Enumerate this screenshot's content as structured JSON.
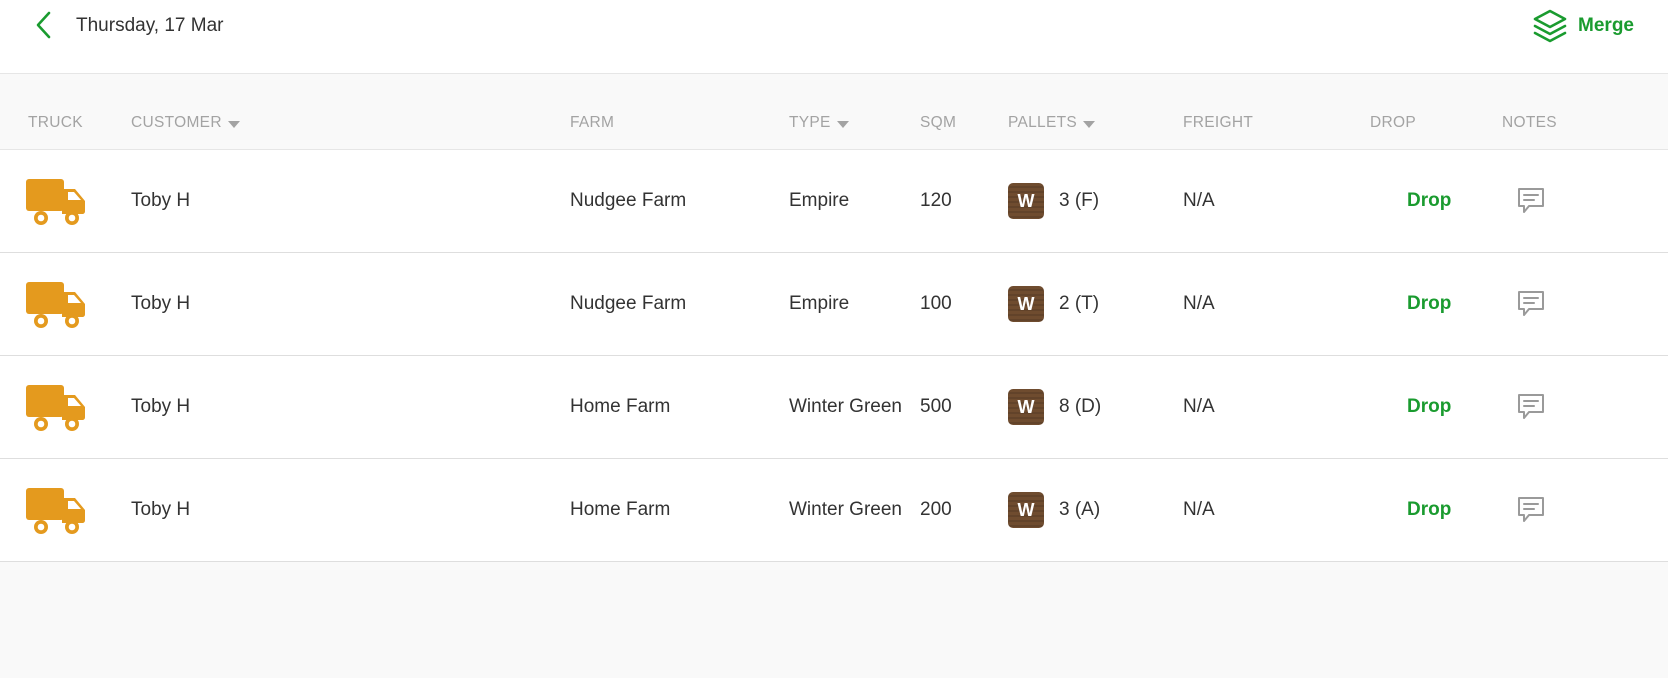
{
  "header": {
    "title": "Thursday, 17 Mar",
    "merge_label": "Merge"
  },
  "colors": {
    "accent": "#1a9b2f",
    "truck": "#e49a1e",
    "badge": "#6b4a2e"
  },
  "columns": {
    "truck": "TRUCK",
    "customer": "CUSTOMER",
    "farm": "FARM",
    "type": "TYPE",
    "sqm": "SQM",
    "pallets": "PALLETS",
    "freight": "FREIGHT",
    "drop": "DROP",
    "notes": "NOTES"
  },
  "rows": [
    {
      "customer": "Toby H",
      "farm": "Nudgee Farm",
      "type": "Empire",
      "sqm": "120",
      "badge": "W",
      "pallets": "3 (F)",
      "freight": "N/A",
      "drop": "Drop"
    },
    {
      "customer": "Toby H",
      "farm": "Nudgee Farm",
      "type": "Empire",
      "sqm": "100",
      "badge": "W",
      "pallets": "2 (T)",
      "freight": "N/A",
      "drop": "Drop"
    },
    {
      "customer": "Toby H",
      "farm": "Home Farm",
      "type": "Winter Green",
      "sqm": "500",
      "badge": "W",
      "pallets": "8 (D)",
      "freight": "N/A",
      "drop": "Drop"
    },
    {
      "customer": "Toby H",
      "farm": "Home Farm",
      "type": "Winter Green",
      "sqm": "200",
      "badge": "W",
      "pallets": "3 (A)",
      "freight": "N/A",
      "drop": "Drop"
    }
  ]
}
